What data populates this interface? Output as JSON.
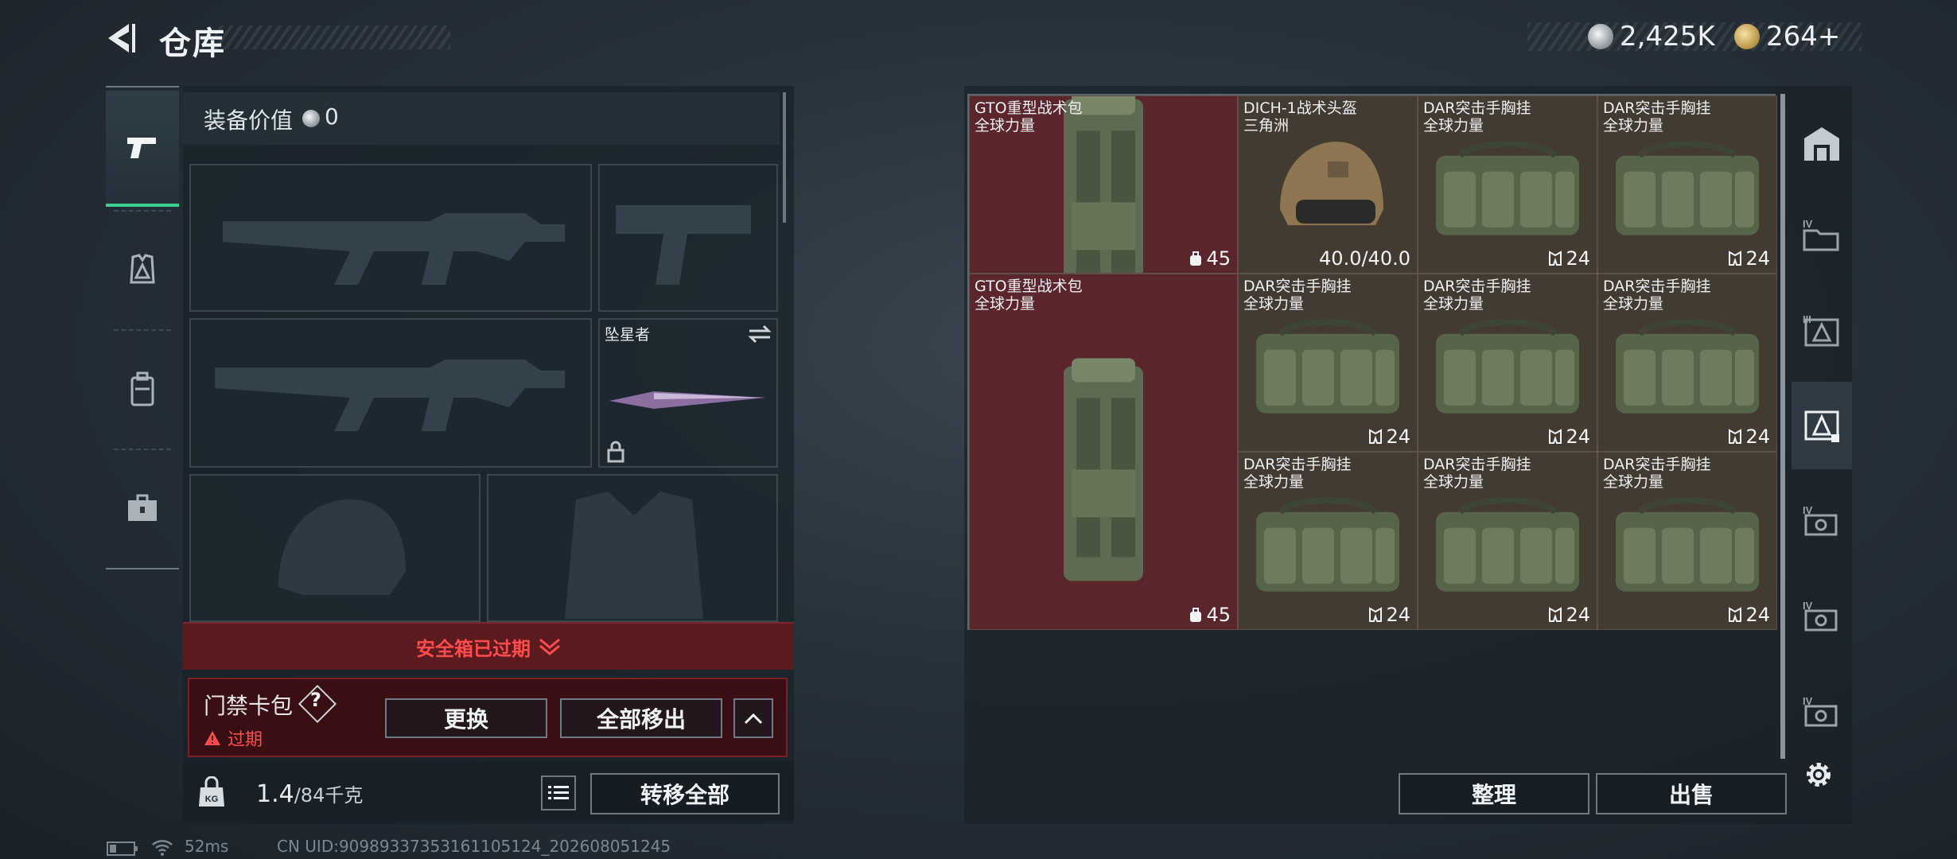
{
  "header": {
    "title": "仓库",
    "currency_silver": "2,425K",
    "currency_gold": "264+"
  },
  "equipment": {
    "value_label": "装备价值",
    "value": "0",
    "melee_name": "坠星者"
  },
  "safebox": {
    "expired_label": "安全箱已过期"
  },
  "keycard": {
    "name": "门禁卡包",
    "help": "?",
    "status": "过期",
    "replace_label": "更换",
    "remove_all_label": "全部移出"
  },
  "weight": {
    "current": "1.4",
    "max": "/84千克",
    "transfer_all_label": "转移全部"
  },
  "storage": {
    "items": [
      {
        "name": "GTO重型战术包\n全球力量",
        "count": "45",
        "kind": "backpack"
      },
      {
        "name": "DICH-1战术头盔\n三角洲",
        "count": "40.0/40.0",
        "kind": "helmet"
      },
      {
        "name": "DAR突击手胸挂\n全球力量",
        "count": "24",
        "kind": "rig"
      },
      {
        "name": "DAR突击手胸挂\n全球力量",
        "count": "24",
        "kind": "rig"
      },
      {
        "name": "DAR突击手胸挂\n全球力量",
        "count": "24",
        "kind": "rig"
      },
      {
        "name": "DAR突击手胸挂\n全球力量",
        "count": "24",
        "kind": "rig"
      },
      {
        "name": "DAR突击手胸挂\n全球力量",
        "count": "24",
        "kind": "rig"
      },
      {
        "name": "GTO重型战术包\n全球力量",
        "count": "45",
        "kind": "backpack"
      },
      {
        "name": "DAR突击手胸挂\n全球力量",
        "count": "24",
        "kind": "rig"
      },
      {
        "name": "DAR突击手胸挂\n全球力量",
        "count": "24",
        "kind": "rig"
      },
      {
        "name": "DAR突击手胸挂\n全球力量",
        "count": "24",
        "kind": "rig"
      }
    ],
    "sort_label": "整理",
    "sell_label": "出售"
  },
  "status_bar": {
    "ping": "52ms",
    "uid": "CN UID:9098933735316110512​4_202608051245"
  },
  "colors": {
    "accent_green": "#3ad08f",
    "danger_red": "#ff4b4b",
    "item_red_bg": "#5b262b",
    "item_brown_bg": "#433a31"
  }
}
